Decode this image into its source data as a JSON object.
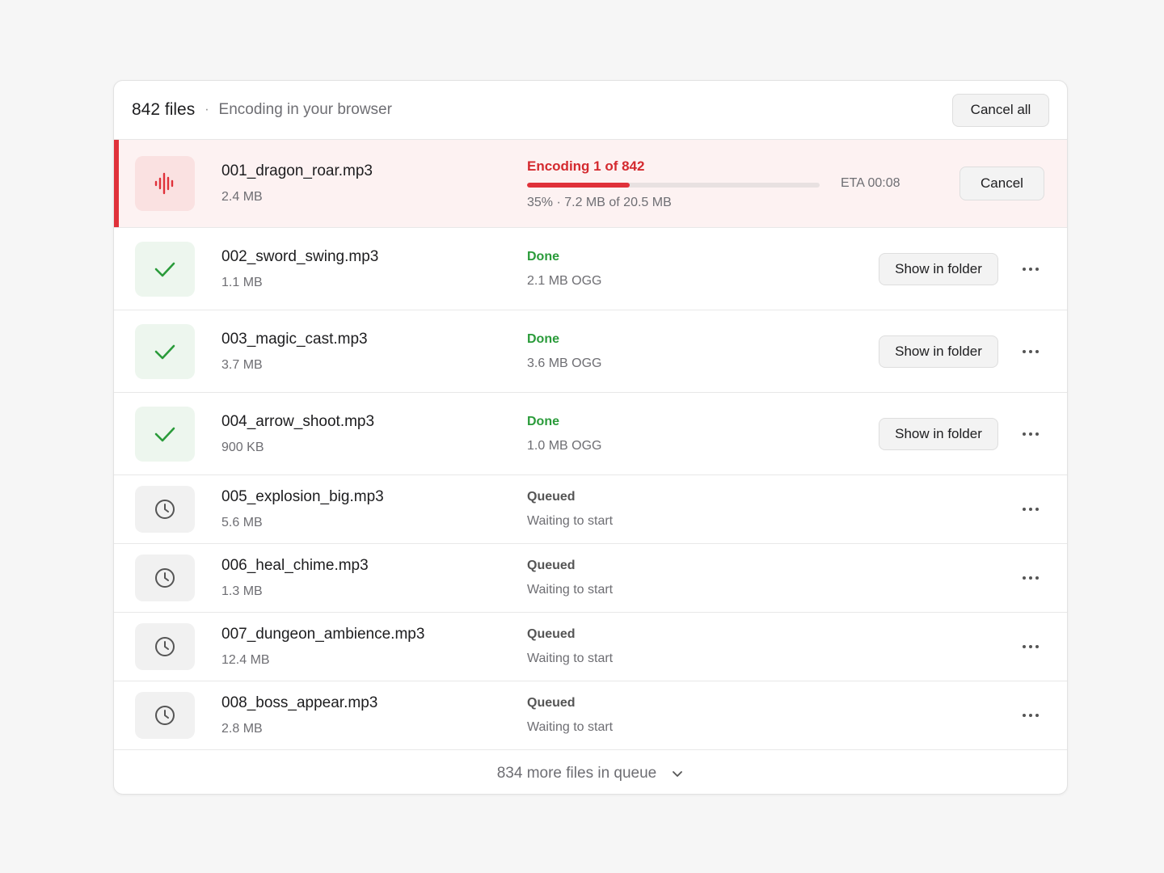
{
  "header": {
    "count": "842 files",
    "separator": "·",
    "subtitle": "Encoding in your browser",
    "cancel_all_label": "Cancel all"
  },
  "active": {
    "name": "001_dragon_roar.mp3",
    "size": "2.4 MB",
    "status": "Encoding 1 of 842",
    "progress_percent": 35,
    "progress_detail": "35% · 7.2 MB of 20.5 MB",
    "eta": "ETA 00:08",
    "cancel_label": "Cancel",
    "icon": "waveform-icon"
  },
  "done_rows": [
    {
      "name": "002_sword_swing.mp3",
      "size": "1.1 MB",
      "status": "Done",
      "detail": "2.1 MB OGG",
      "action": "Show in folder"
    },
    {
      "name": "003_magic_cast.mp3",
      "size": "3.7 MB",
      "status": "Done",
      "detail": "3.6 MB OGG",
      "action": "Show in folder"
    },
    {
      "name": "004_arrow_shoot.mp3",
      "size": "900 KB",
      "status": "Done",
      "detail": "1.0 MB OGG",
      "action": "Show in folder"
    }
  ],
  "queued_rows": [
    {
      "name": "005_explosion_big.mp3",
      "size": "5.6 MB",
      "status": "Queued",
      "detail": "Waiting to start"
    },
    {
      "name": "006_heal_chime.mp3",
      "size": "1.3 MB",
      "status": "Queued",
      "detail": "Waiting to start"
    },
    {
      "name": "007_dungeon_ambience.mp3",
      "size": "12.4 MB",
      "status": "Queued",
      "detail": "Waiting to start"
    },
    {
      "name": "008_boss_appear.mp3",
      "size": "2.8 MB",
      "status": "Queued",
      "detail": "Waiting to start"
    }
  ],
  "footer": {
    "label": "834 more files in queue"
  },
  "colors": {
    "accent": "#e0313a",
    "done": "#2a9b3a",
    "muted": "#6e6e73"
  }
}
